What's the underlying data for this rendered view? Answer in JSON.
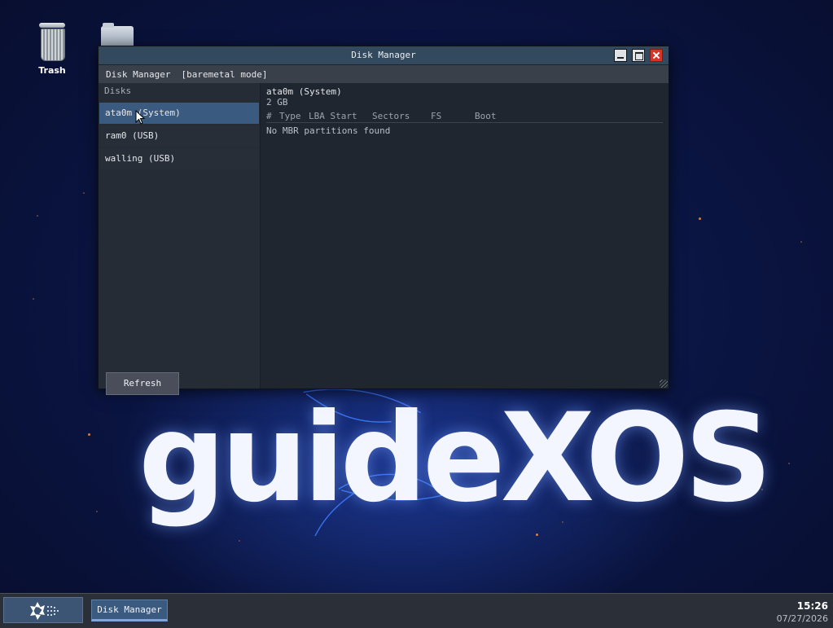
{
  "desktop": {
    "wallpaper_text": "guideXOS",
    "icons": [
      {
        "label": "Trash",
        "icon": "trash-icon"
      },
      {
        "label": "",
        "icon": "folder-icon"
      }
    ]
  },
  "window": {
    "title": "Disk Manager",
    "menu": {
      "app_label": "Disk Manager",
      "mode_label": "[baremetal mode]"
    },
    "sidebar": {
      "header": "Disks",
      "items": [
        {
          "label": "ata0m (System)",
          "selected": true
        },
        {
          "label": "ram0 (USB)",
          "selected": false
        },
        {
          "label": "walling (USB)",
          "selected": false
        }
      ],
      "refresh_label": "Refresh"
    },
    "detail": {
      "disk_name": "ata0m (System)",
      "disk_size": "2 GB",
      "columns": [
        "#",
        "Type",
        "LBA Start",
        "Sectors",
        "FS",
        "Boot"
      ],
      "empty_message": "No MBR partitions found"
    }
  },
  "taskbar": {
    "start_icon": "guidexos-logo-icon",
    "tasks": [
      {
        "label": "Disk Manager",
        "active": true
      }
    ],
    "clock": {
      "time": "15:26",
      "date": "07/27/2026"
    }
  },
  "colors": {
    "titlebar": "#334a5e",
    "selection": "#3b5a80",
    "close_button": "#d6342b",
    "desktop_bg": "#0a1440"
  }
}
